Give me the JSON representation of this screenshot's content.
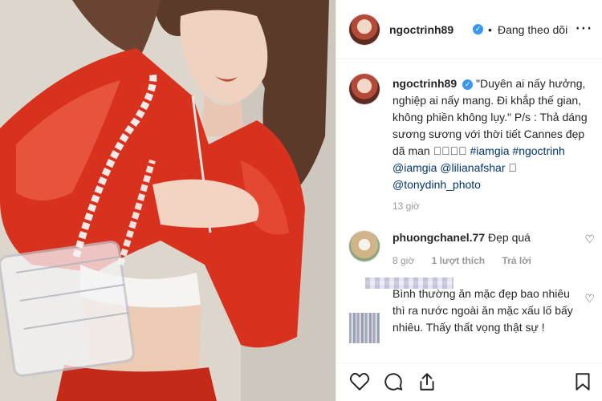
{
  "header": {
    "username": "ngoctrinh89",
    "separator": "•",
    "follow_status": "Đang theo dõi",
    "more_icon": "more-horizontal-icon"
  },
  "caption": {
    "username": "ngoctrinh89",
    "text": "\"Duyên ai nấy hưởng, nghiệp ai nấy mang. Đi khắp thế gian, không phiền không lụy.\" P/s : Thả dáng sương sương với thời tiết Cannes đẹp dã man 🏻🏻🏻🏻",
    "tags": [
      "#iamgia",
      "#ngoctrinh",
      "@iamgia",
      "@lilianafshar",
      "🏻",
      "@tonydinh_photo"
    ],
    "time": "13 giờ"
  },
  "comments": [
    {
      "username": "phuongchanel.77",
      "text": "Đẹp quá",
      "time": "8 giờ",
      "likes": "1 lượt thích",
      "reply": "Trả lời"
    },
    {
      "text": "Bình thường ăn mặc đẹp bao nhiêu thì ra nước ngoài ăn mặc xấu lố bấy nhiêu. Thấy thất vọng thật sự !"
    }
  ],
  "actions": {
    "like_icon": "heart-icon",
    "comment_icon": "comment-icon",
    "share_icon": "share-icon",
    "save_icon": "bookmark-icon"
  },
  "colors": {
    "verified": "#3897f0",
    "tag": "#003569",
    "muted": "#999999",
    "jacket": "#d8321f"
  }
}
